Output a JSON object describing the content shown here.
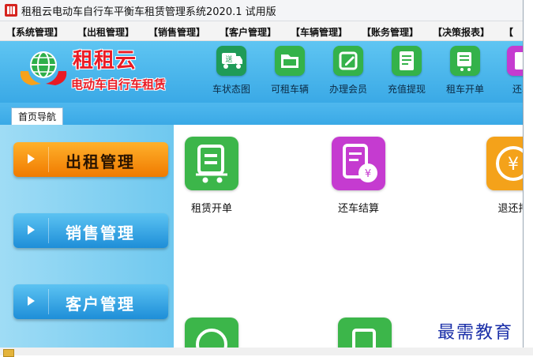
{
  "window": {
    "title": "租租云电动车自行车平衡车租赁管理系统2020.1 试用版"
  },
  "menu": {
    "items": [
      "【系统管理】",
      "【出租管理】",
      "【销售管理】",
      "【客户管理】",
      "【车辆管理】",
      "【账务管理】",
      "【决策报表】",
      "【"
    ]
  },
  "logo": {
    "title": "租租云",
    "subtitle": "电动车自行车租赁"
  },
  "toolbar": {
    "items": [
      {
        "label": "车状态图",
        "icon": "delivery-icon",
        "color": "#1f9b57"
      },
      {
        "label": "可租车辆",
        "icon": "folder-icon",
        "color": "#34b24a"
      },
      {
        "label": "办理会员",
        "icon": "edit-icon",
        "color": "#34b24a"
      },
      {
        "label": "充值提现",
        "icon": "document-icon",
        "color": "#34b24a"
      },
      {
        "label": "租车开单",
        "icon": "cart-icon",
        "color": "#34b24a"
      },
      {
        "label": "还车",
        "icon": "receipt-icon",
        "color": "#c53bd0"
      }
    ]
  },
  "tabs": [
    {
      "label": "首页导航"
    }
  ],
  "nav": {
    "items": [
      {
        "label": "出租管理",
        "style": "orange"
      },
      {
        "label": "销售管理",
        "style": "blue"
      },
      {
        "label": "客户管理",
        "style": "blue"
      }
    ]
  },
  "main": {
    "functions": [
      {
        "label": "租赁开单",
        "icon": "cart-icon",
        "color": "#3cb64a"
      },
      {
        "label": "还车结算",
        "icon": "receipt-yen-icon",
        "color": "#c53bd0"
      },
      {
        "label": "退还押",
        "icon": "yen-icon",
        "color": "#f4a21a"
      }
    ]
  },
  "watermark": "最需教育",
  "colors": {
    "banner": "#3aa9e6",
    "accent_orange": "#f07a00",
    "brand_red": "#e91b24"
  }
}
